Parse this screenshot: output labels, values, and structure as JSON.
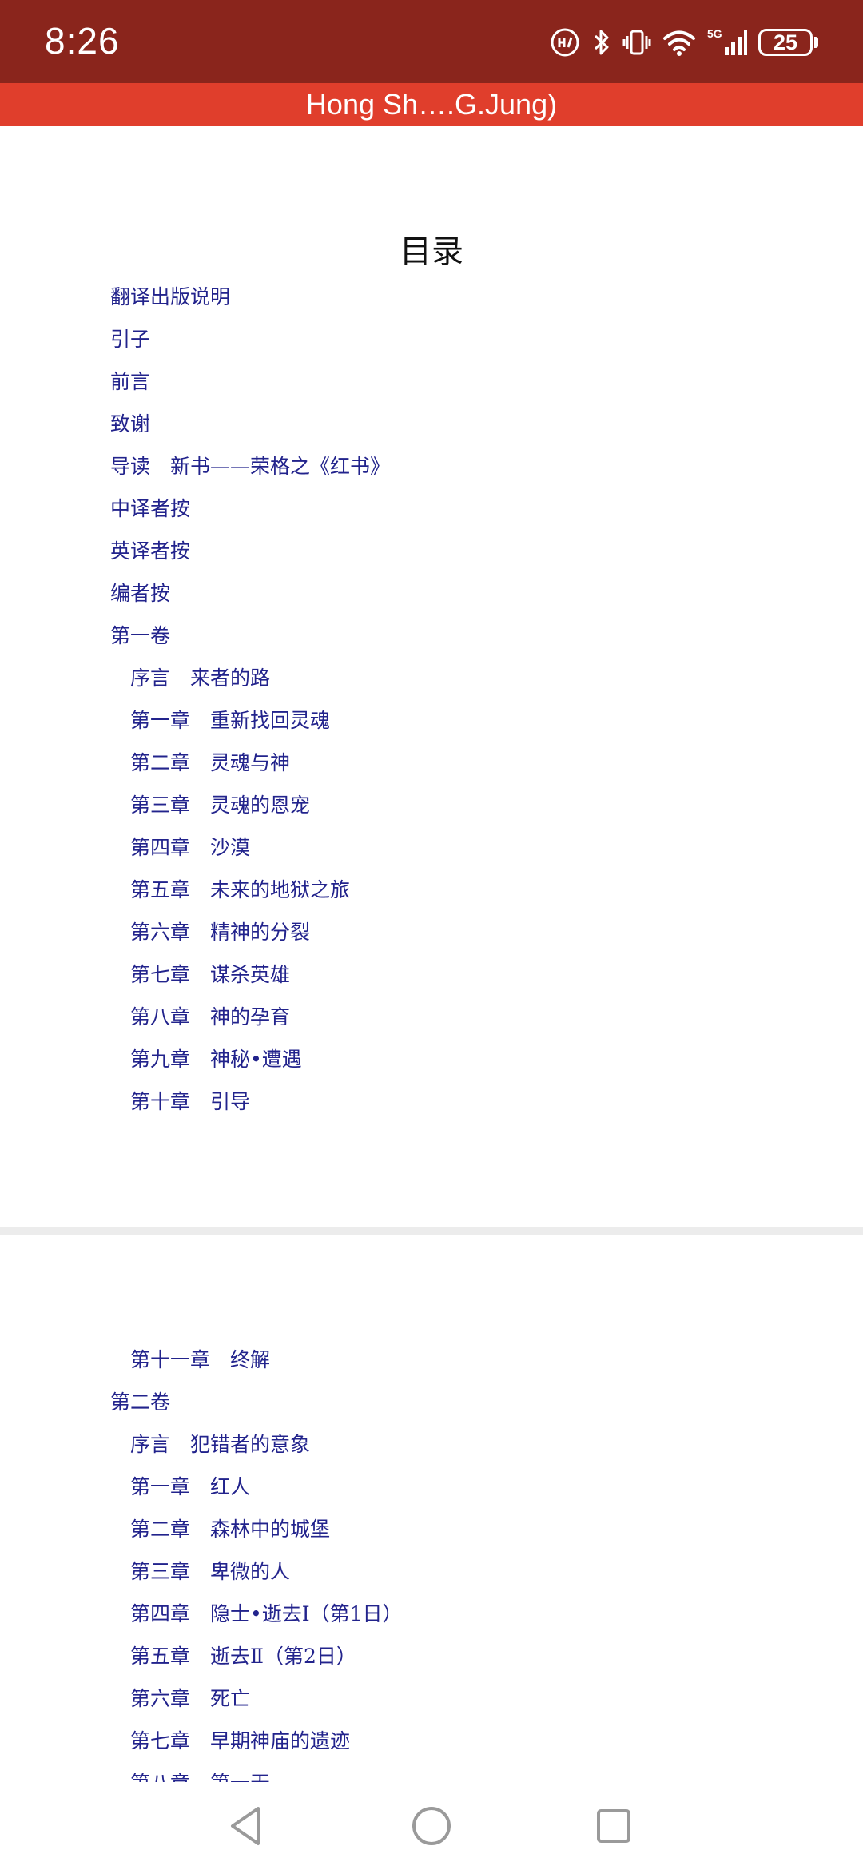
{
  "status_bar": {
    "time": "8:26",
    "battery": "25",
    "icons": [
      "hd-call-icon",
      "bluetooth-icon",
      "vibrate-icon",
      "wifi-icon",
      "5g-signal-icon",
      "battery-icon"
    ],
    "network_label": "5G"
  },
  "title_bar": {
    "title": "Hong Sh….G.Jung)"
  },
  "toc": {
    "heading": "目录",
    "page1": [
      {
        "text": "翻译出版说明",
        "level": 1
      },
      {
        "text": "引子",
        "level": 1
      },
      {
        "text": "前言",
        "level": 1
      },
      {
        "text": "致谢",
        "level": 1
      },
      {
        "text": "导读　新书——荣格之《红书》",
        "level": 1
      },
      {
        "text": "中译者按",
        "level": 1
      },
      {
        "text": "英译者按",
        "level": 1
      },
      {
        "text": "编者按",
        "level": 1
      },
      {
        "text": "第一卷",
        "level": 1
      },
      {
        "text": "序言　来者的路",
        "level": 2
      },
      {
        "text": "第一章　重新找回灵魂",
        "level": 2
      },
      {
        "text": "第二章　灵魂与神",
        "level": 2
      },
      {
        "text": "第三章　灵魂的恩宠",
        "level": 2
      },
      {
        "text": "第四章　沙漠",
        "level": 2
      },
      {
        "text": "第五章　未来的地狱之旅",
        "level": 2
      },
      {
        "text": "第六章　精神的分裂",
        "level": 2
      },
      {
        "text": "第七章　谋杀英雄",
        "level": 2
      },
      {
        "text": "第八章　神的孕育",
        "level": 2
      },
      {
        "text": "第九章　神秘•遭遇",
        "level": 2
      },
      {
        "text": "第十章　引导",
        "level": 2
      }
    ],
    "page2": [
      {
        "text": "第十一章　终解",
        "level": 2
      },
      {
        "text": "第二卷",
        "level": 1
      },
      {
        "text": "序言　犯错者的意象",
        "level": 2
      },
      {
        "text": "第一章　红人",
        "level": 2
      },
      {
        "text": "第二章　森林中的城堡",
        "level": 2
      },
      {
        "text": "第三章　卑微的人",
        "level": 2
      },
      {
        "text": "第四章　隐士•逝去Ⅰ（第1日）",
        "level": 2
      },
      {
        "text": "第五章　逝去Ⅱ（第2日）",
        "level": 2
      },
      {
        "text": "第六章　死亡",
        "level": 2
      },
      {
        "text": "第七章　早期神庙的遗迹",
        "level": 2
      },
      {
        "text": "第八章　第一天",
        "level": 2
      }
    ]
  },
  "colors": {
    "status_bar": "#8a251c",
    "title_bar": "#e03e2c",
    "link": "#22238c"
  }
}
